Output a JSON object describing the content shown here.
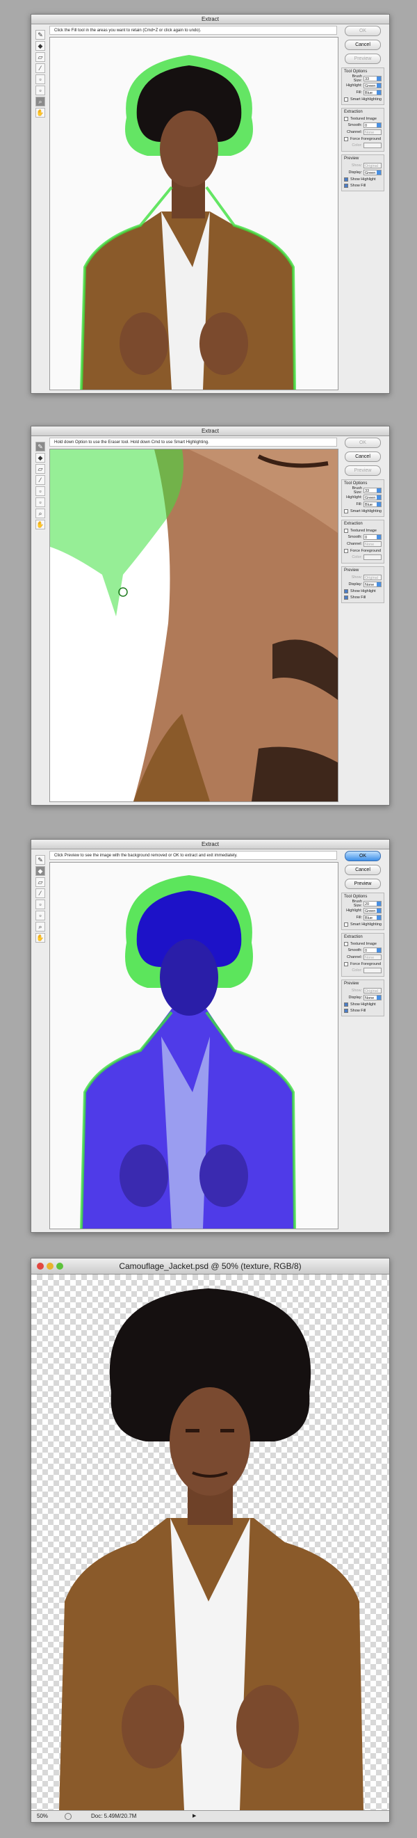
{
  "window1": {
    "title": "Extract",
    "instruction": "Click the Fill tool in the areas you want to retain (Cmd+Z or click again to undo)."
  },
  "window2": {
    "title": "Extract",
    "instruction": "Hold down Option to use the Eraser tool. Hold down Cmd to use Smart Highlighting."
  },
  "window3": {
    "title": "Extract",
    "instruction": "Click Preview to see the image with the background removed or OK to extract and exit immediately."
  },
  "dialog": {
    "ok": "OK",
    "cancel": "Cancel",
    "preview": "Preview",
    "tool_options": "Tool Options",
    "brush_size_label": "Brush Size:",
    "brush_size_value": "33",
    "brush_size_value_2": "20",
    "highlight_label": "Highlight:",
    "highlight_value": "Green",
    "fill_label": "Fill:",
    "fill_value": "Blue",
    "smart_highlighting": "Smart Highlighting",
    "extraction": "Extraction",
    "textured_image": "Textured Image",
    "smooth_label": "Smooth:",
    "smooth_value": "0",
    "channel_label": "Channel:",
    "channel_value": "None",
    "force_foreground": "Force Foreground",
    "color_label": "Color:",
    "preview_group": "Preview",
    "show_label": "Show:",
    "show_value": "Original",
    "display_label": "Display:",
    "display_value_1": "Green",
    "display_value_2": "None",
    "show_highlight": "Show Highlight",
    "show_fill": "Show Fill"
  },
  "final_window": {
    "title": "Camouflage_Jacket.psd @ 50% (texture, RGB/8)",
    "zoom": "50%",
    "doc_info": "Doc: 5.49M/20.7M"
  },
  "colors": {
    "highlight_green": "#3fe03f",
    "fill_blue": "#2a1ee0",
    "jacket": "#8a5a2a",
    "skin": "#7a4a30",
    "hair": "#151010"
  }
}
